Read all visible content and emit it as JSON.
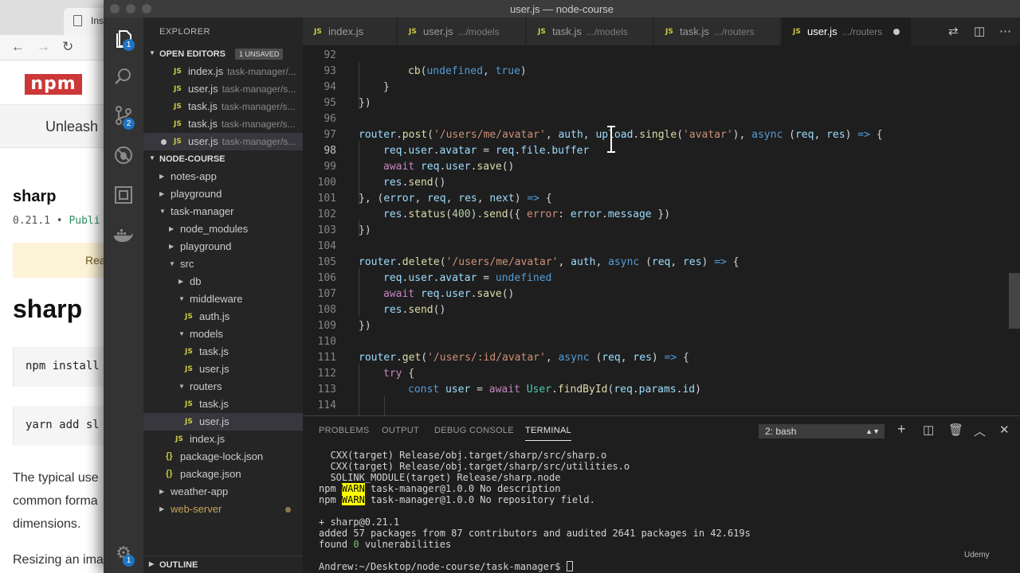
{
  "browser": {
    "tab_title": "Ins",
    "banner_text": "Unleash",
    "package": {
      "name": "sharp",
      "version_line": "0.21.1 • ",
      "version_public": "Publi"
    },
    "readme_label": "Rea",
    "install_npm": "npm install",
    "install_yarn": "yarn add sl",
    "paragraph_lines": [
      "The typical use",
      "common forma",
      "dimensions."
    ],
    "paragraph2": "Resizing an ima",
    "nav": {
      "back": "←",
      "forward": "→",
      "reload": "↻"
    },
    "logo": "npm"
  },
  "window": {
    "title": "user.js — node-course"
  },
  "activity": {
    "explorer_badge": "1",
    "scm_badge": "2",
    "settings_badge": "1"
  },
  "sidebar": {
    "title": "EXPLORER",
    "open_editors": {
      "label": "OPEN EDITORS",
      "badge": "1 UNSAVED",
      "items": [
        {
          "name": "index.js",
          "path": "task-manager/..."
        },
        {
          "name": "user.js",
          "path": "task-manager/s..."
        },
        {
          "name": "task.js",
          "path": "task-manager/s..."
        },
        {
          "name": "task.js",
          "path": "task-manager/s..."
        },
        {
          "name": "user.js",
          "path": "task-manager/s..."
        }
      ]
    },
    "workspace": "NODE-COURSE",
    "tree": [
      "notes-app",
      "playground",
      "task-manager",
      "node_modules",
      "playground",
      "src",
      "db",
      "middleware",
      "auth.js",
      "models",
      "task.js",
      "user.js",
      "routers",
      "task.js",
      "user.js",
      "index.js",
      "package-lock.json",
      "package.json",
      "weather-app",
      "web-server"
    ],
    "outline": "OUTLINE"
  },
  "tabs": [
    {
      "name": "index.js",
      "path": ""
    },
    {
      "name": "user.js",
      "path": ".../models"
    },
    {
      "name": "task.js",
      "path": ".../models"
    },
    {
      "name": "task.js",
      "path": ".../routers"
    },
    {
      "name": "user.js",
      "path": ".../routers"
    }
  ],
  "editor": {
    "line_numbers": [
      "92",
      "93",
      "94",
      "95",
      "96",
      "97",
      "98",
      "99",
      "100",
      "101",
      "102",
      "103",
      "104",
      "105",
      "106",
      "107",
      "108",
      "109",
      "110",
      "111",
      "112",
      "113",
      "114"
    ],
    "code": {
      "l93": [
        "cb",
        "(",
        "undefined",
        ", ",
        "true",
        ")"
      ],
      "l94": "}",
      "l95": "})",
      "l97": [
        "router",
        ".",
        "post",
        "(",
        "'/users/me/avatar'",
        ", ",
        "auth",
        ", ",
        "upload",
        ".",
        "single",
        "(",
        "'avatar'",
        "), ",
        "async",
        " (",
        "req",
        ", ",
        "res",
        ") ",
        "=>",
        " {"
      ],
      "l98": [
        "req",
        ".",
        "user",
        ".",
        "avatar",
        " = ",
        "req",
        ".",
        "file",
        ".",
        "buffer"
      ],
      "l99": [
        "await",
        " ",
        "req",
        ".",
        "user",
        ".",
        "save",
        "()"
      ],
      "l100": [
        "res",
        ".",
        "send",
        "()"
      ],
      "l101": [
        "}, (",
        "error",
        ", ",
        "req",
        ", ",
        "res",
        ", ",
        "next",
        ") ",
        "=>",
        " {"
      ],
      "l102": [
        "res",
        ".",
        "status",
        "(",
        "400",
        ").",
        "send",
        "({ ",
        "error",
        ": ",
        "error",
        ".",
        "message",
        " })"
      ],
      "l103": "})",
      "l105": [
        "router",
        ".",
        "delete",
        "(",
        "'/users/me/avatar'",
        ", ",
        "auth",
        ", ",
        "async",
        " (",
        "req",
        ", ",
        "res",
        ") ",
        "=>",
        " {"
      ],
      "l106": [
        "req",
        ".",
        "user",
        ".",
        "avatar",
        " = ",
        "undefined"
      ],
      "l107": [
        "await",
        " ",
        "req",
        ".",
        "user",
        ".",
        "save",
        "()"
      ],
      "l108": [
        "res",
        ".",
        "send",
        "()"
      ],
      "l109": "})",
      "l111": [
        "router",
        ".",
        "get",
        "(",
        "'/users/:id/avatar'",
        ", ",
        "async",
        " (",
        "req",
        ", ",
        "res",
        ") ",
        "=>",
        " {"
      ],
      "l112": [
        "try",
        " {"
      ],
      "l113": [
        "const",
        " ",
        "user",
        " = ",
        "await",
        " ",
        "User",
        ".",
        "findById",
        "(",
        "req",
        ".",
        "params",
        ".",
        "id",
        ")"
      ]
    }
  },
  "panel": {
    "tabs": [
      "PROBLEMS",
      "OUTPUT",
      "DEBUG CONSOLE",
      "TERMINAL"
    ],
    "terminal_select": "2: bash",
    "lines": {
      "t1": "  CXX(target) Release/obj.target/sharp/src/sharp.o",
      "t2": "  CXX(target) Release/obj.target/sharp/src/utilities.o",
      "t3": "  SOLINK_MODULE(target) Release/sharp.node",
      "t4_pre": "npm ",
      "t4_warn": "WARN",
      "t4_post": " task-manager@1.0.0 No description",
      "t5_pre": "npm ",
      "t5_warn": "WARN",
      "t5_post": " task-manager@1.0.0 No repository field.",
      "t6": "+ sharp@0.21.1",
      "t7": "added 57 packages from 87 contributors and audited 2641 packages in 42.619s",
      "t8_pre": "found ",
      "t8_zero": "0",
      "t8_post": " vulnerabilities",
      "prompt": "Andrew:~/Desktop/node-course/task-manager$ "
    }
  },
  "watermark": "Udemy"
}
